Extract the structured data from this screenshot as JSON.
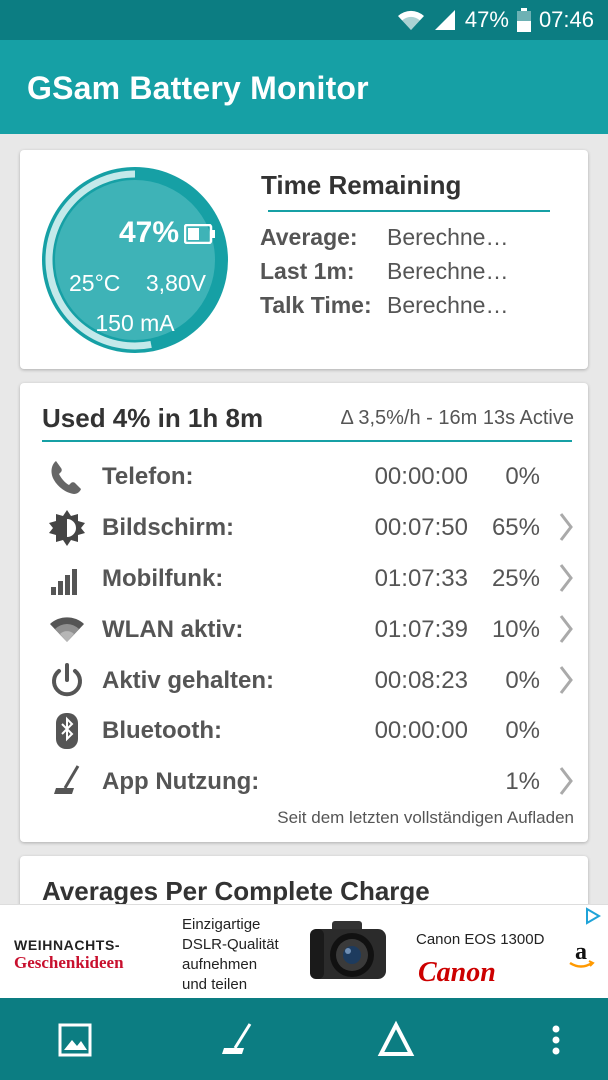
{
  "status_bar": {
    "battery_pct": "47%",
    "time": "07:46"
  },
  "app_title": "GSam Battery Monitor",
  "battery_gauge": {
    "percent": "47%",
    "level": 0.47,
    "temperature": "25°C",
    "voltage": "3,80V",
    "current": "150 mA"
  },
  "time_remaining": {
    "title": "Time Remaining",
    "rows": [
      {
        "label": "Average:",
        "value": "Berechne…"
      },
      {
        "label": "Last 1m:",
        "value": "Berechne…"
      },
      {
        "label": "Talk Time:",
        "value": "Berechne…"
      }
    ]
  },
  "usage": {
    "title": "Used 4% in 1h 8m",
    "rate": "Δ 3,5%/h - 16m 13s Active",
    "rows": [
      {
        "icon": "phone-icon",
        "label": "Telefon:",
        "time": "00:00:00",
        "pct": "0%",
        "chevron": false
      },
      {
        "icon": "brightness-icon",
        "label": "Bildschirm:",
        "time": "00:07:50",
        "pct": "65%",
        "chevron": true
      },
      {
        "icon": "signal-bars-icon",
        "label": "Mobilfunk:",
        "time": "01:07:33",
        "pct": "25%",
        "chevron": true
      },
      {
        "icon": "wifi-icon",
        "label": "WLAN aktiv:",
        "time": "01:07:39",
        "pct": "10%",
        "chevron": true
      },
      {
        "icon": "power-icon",
        "label": "Aktiv gehalten:",
        "time": "00:08:23",
        "pct": "0%",
        "chevron": true
      },
      {
        "icon": "bluetooth-icon",
        "label": "Bluetooth:",
        "time": "00:00:00",
        "pct": "0%",
        "chevron": false
      },
      {
        "icon": "broom-icon",
        "label": "App Nutzung:",
        "time": "",
        "pct": "1%",
        "chevron": true
      }
    ],
    "footnote": "Seit dem letzten vollständigen Aufladen"
  },
  "averages": {
    "title": "Averages Per Complete Charge"
  },
  "ad": {
    "left_line1": "WEIHNACHTS-",
    "left_line2": "Geschenkideen",
    "middle_lines": [
      "Einzigartige",
      "DSLR-Qualität",
      "aufnehmen",
      "und teilen"
    ],
    "model": "Canon EOS 1300D",
    "brand": "Canon",
    "amazon": "a"
  },
  "bottom_nav": [
    "gallery-icon",
    "broom-icon",
    "delta-icon",
    "more-vert-icon"
  ],
  "colors": {
    "primary": "#16a0a5",
    "primary_dark": "#0c7d82",
    "text": "#555555"
  }
}
